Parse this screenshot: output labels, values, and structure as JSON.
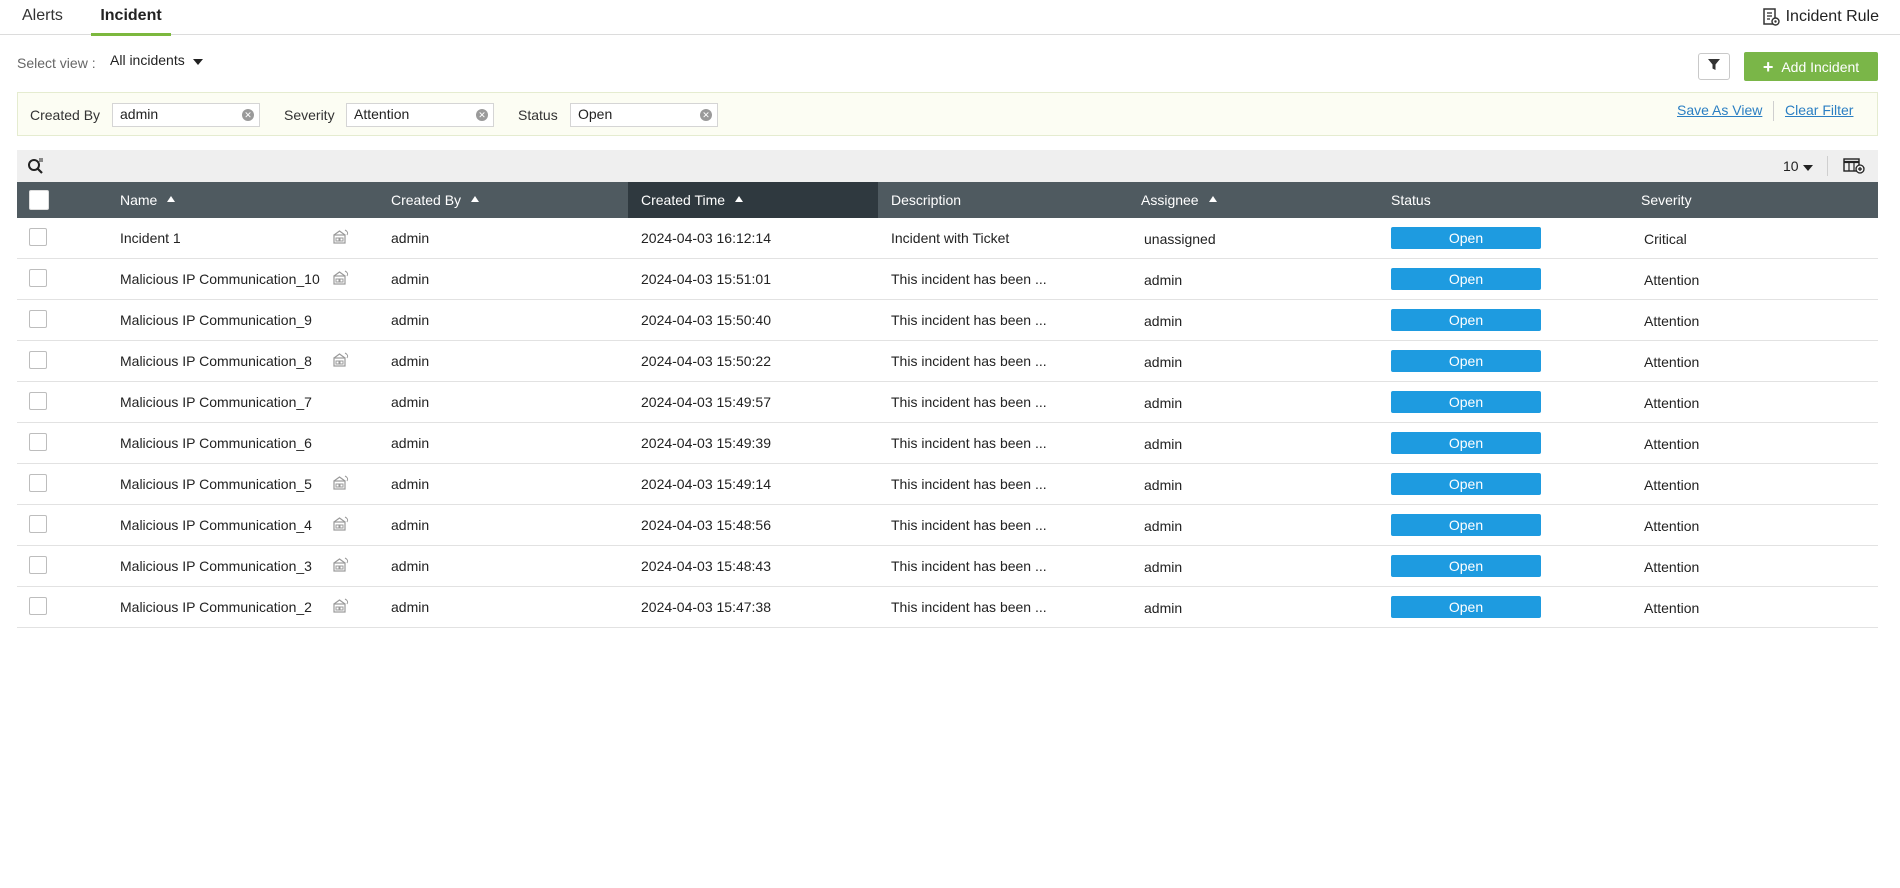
{
  "tabs": [
    {
      "label": "Alerts"
    },
    {
      "label": "Incident"
    }
  ],
  "incident_rule_label": "Incident Rule",
  "view": {
    "label": "Select view :",
    "selected": "All incidents"
  },
  "add_incident_label": "Add Incident",
  "filters": {
    "created_by": {
      "label": "Created By",
      "value": "admin"
    },
    "severity": {
      "label": "Severity",
      "value": "Attention"
    },
    "status": {
      "label": "Status",
      "value": "Open"
    },
    "save_as_view": "Save As View",
    "clear_filter": "Clear Filter"
  },
  "page_size": "10",
  "columns": {
    "name": "Name",
    "created_by": "Created By",
    "created_time": "Created Time",
    "description": "Description",
    "assignee": "Assignee",
    "status": "Status",
    "severity": "Severity"
  },
  "rows": [
    {
      "name": "Incident 1",
      "created_by": "admin",
      "created_time": "2024-04-03 16:12:14",
      "description": "Incident with Ticket",
      "assignee": "unassigned",
      "status": "Open",
      "severity": "Critical"
    },
    {
      "name": "Malicious IP Communication_10",
      "created_by": "admin",
      "created_time": "2024-04-03 15:51:01",
      "description": "This incident has been ...",
      "assignee": "admin",
      "status": "Open",
      "severity": "Attention"
    },
    {
      "name": "Malicious IP Communication_9",
      "created_by": "admin",
      "created_time": "2024-04-03 15:50:40",
      "description": "This incident has been ...",
      "assignee": "admin",
      "status": "Open",
      "severity": "Attention"
    },
    {
      "name": "Malicious IP Communication_8",
      "created_by": "admin",
      "created_time": "2024-04-03 15:50:22",
      "description": "This incident has been ...",
      "assignee": "admin",
      "status": "Open",
      "severity": "Attention"
    },
    {
      "name": "Malicious IP Communication_7",
      "created_by": "admin",
      "created_time": "2024-04-03 15:49:57",
      "description": "This incident has been ...",
      "assignee": "admin",
      "status": "Open",
      "severity": "Attention"
    },
    {
      "name": "Malicious IP Communication_6",
      "created_by": "admin",
      "created_time": "2024-04-03 15:49:39",
      "description": "This incident has been ...",
      "assignee": "admin",
      "status": "Open",
      "severity": "Attention"
    },
    {
      "name": "Malicious IP Communication_5",
      "created_by": "admin",
      "created_time": "2024-04-03 15:49:14",
      "description": "This incident has been ...",
      "assignee": "admin",
      "status": "Open",
      "severity": "Attention"
    },
    {
      "name": "Malicious IP Communication_4",
      "created_by": "admin",
      "created_time": "2024-04-03 15:48:56",
      "description": "This incident has been ...",
      "assignee": "admin",
      "status": "Open",
      "severity": "Attention"
    },
    {
      "name": "Malicious IP Communication_3",
      "created_by": "admin",
      "created_time": "2024-04-03 15:48:43",
      "description": "This incident has been ...",
      "assignee": "admin",
      "status": "Open",
      "severity": "Attention"
    },
    {
      "name": "Malicious IP Communication_2",
      "created_by": "admin",
      "created_time": "2024-04-03 15:47:38",
      "description": "This incident has been ...",
      "assignee": "admin",
      "status": "Open",
      "severity": "Attention"
    }
  ],
  "colors": {
    "accent_green": "#7ab648",
    "status_blue": "#1e9be0",
    "header_bg": "#4f5a60",
    "link_blue": "#2b7fc3"
  }
}
